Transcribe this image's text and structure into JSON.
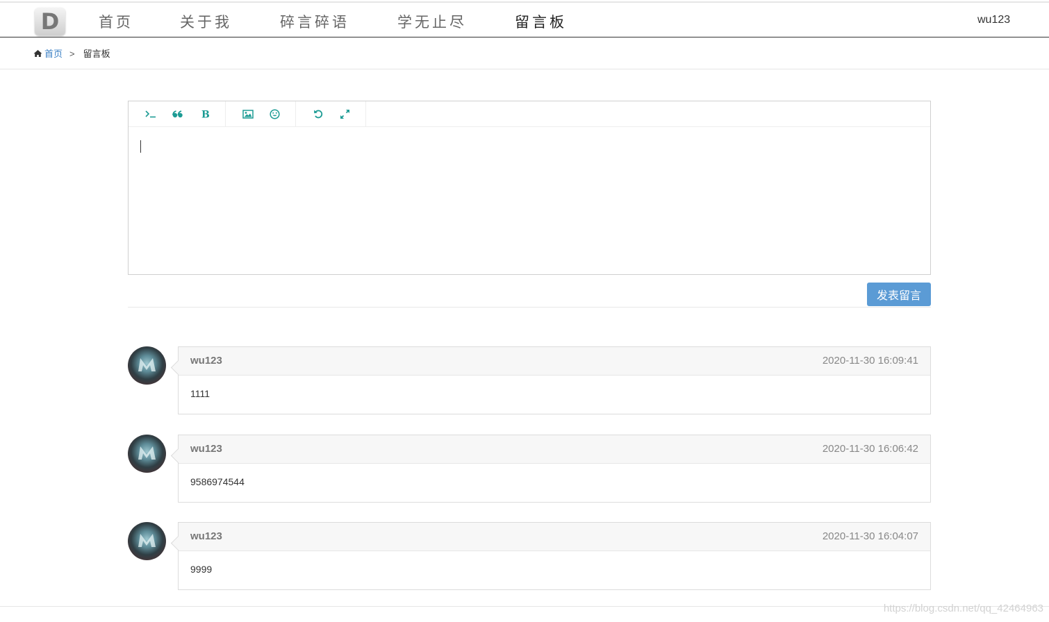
{
  "header": {
    "logo_letter": "D",
    "nav": [
      {
        "label": "首页",
        "active": false
      },
      {
        "label": "关于我",
        "active": false
      },
      {
        "label": "碎言碎语",
        "active": false
      },
      {
        "label": "学无止尽",
        "active": false
      },
      {
        "label": "留言板",
        "active": true
      }
    ],
    "user": "wu123"
  },
  "breadcrumb": {
    "home_icon": "home-icon",
    "home": "首页",
    "separator": ">",
    "current": "留言板"
  },
  "editor": {
    "tools": [
      [
        "terminal-icon",
        "quote-icon",
        "bold-icon"
      ],
      [
        "image-icon",
        "smile-icon"
      ],
      [
        "undo-icon",
        "fullscreen-icon"
      ]
    ],
    "content": "",
    "submit_label": "发表留言"
  },
  "colors": {
    "accent": "#1c9b94",
    "button": "#5b9bd5",
    "link": "#3a7fc4"
  },
  "comments": [
    {
      "author": "wu123",
      "time": "2020-11-30 16:09:41",
      "content": "1111"
    },
    {
      "author": "wu123",
      "time": "2020-11-30 16:06:42",
      "content": "9586974544"
    },
    {
      "author": "wu123",
      "time": "2020-11-30 16:04:07",
      "content": "9999"
    }
  ],
  "watermark": "https://blog.csdn.net/qq_42464963"
}
